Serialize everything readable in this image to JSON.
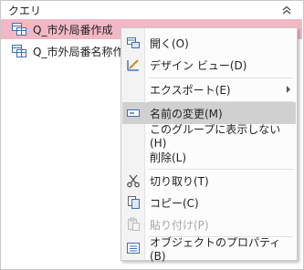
{
  "nav": {
    "title": "クエリ",
    "items": [
      {
        "label": "Q_市外局番作成"
      },
      {
        "label": "Q_市外局番名称作成"
      }
    ]
  },
  "menu": {
    "open": "開く(O)",
    "design_view": "デザイン ビュー(D)",
    "export": "エクスポート(E)",
    "rename": "名前の変更(M)",
    "hide_in_group": "このグループに表示しない(H)",
    "delete": "削除(L)",
    "cut": "切り取り(T)",
    "copy": "コピー(C)",
    "paste": "貼り付け(P)",
    "properties": "オブジェクトのプロパティ(B)"
  },
  "colors": {
    "selected_item": "#f2b8c6",
    "highlighted_menu_item": "#d0d0d0",
    "query_icon": "#3b6fb6"
  }
}
